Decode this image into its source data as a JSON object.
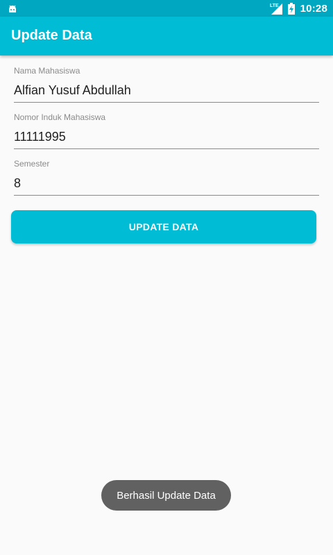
{
  "status_bar": {
    "network_label": "LTE",
    "time": "10:28",
    "icons": [
      "android-icon",
      "signal-icon",
      "battery-charging-icon"
    ]
  },
  "app_bar": {
    "title": "Update Data",
    "color": "#00bcd4"
  },
  "form": {
    "nama": {
      "label": "Nama Mahasiswa",
      "value": "Alfian Yusuf Abdullah"
    },
    "nim": {
      "label": "Nomor Induk Mahasiswa",
      "value": "11111995"
    },
    "semester": {
      "label": "Semester",
      "value": "8"
    }
  },
  "update_button": {
    "label": "UPDATE DATA"
  },
  "toast": {
    "message": "Berhasil Update Data"
  }
}
